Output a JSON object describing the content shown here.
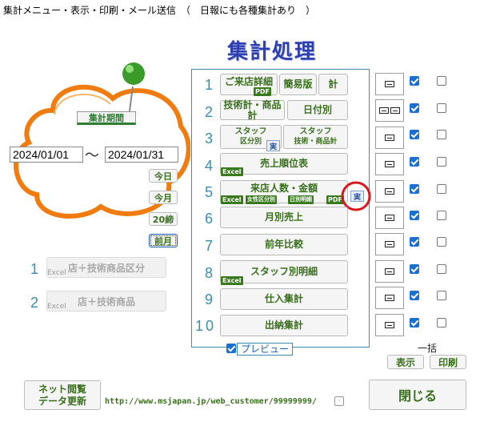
{
  "window": {
    "title": "集計メニュー・表示・印刷・メール送信　（　日報にも各種集計あり　）"
  },
  "header": {
    "title": "集計処理"
  },
  "period": {
    "label": "集計期間",
    "start": "2024/01/01",
    "tilde": "～",
    "end": "2024/01/31",
    "today": "今日",
    "month": "今月",
    "close20": "20締",
    "prev_month": "前月"
  },
  "extra": [
    {
      "num": "1",
      "label": "店＋技術商品区分",
      "sub": "Excel"
    },
    {
      "num": "2",
      "label": "店＋技術商品",
      "sub": "Excel"
    }
  ],
  "rows": [
    {
      "num": "1",
      "b1": "ご来店詳細",
      "b1tag": "PDF",
      "b2": "簡易版",
      "b3": "計"
    },
    {
      "num": "2",
      "b1": "技術計・商品計",
      "b2": "日付別"
    },
    {
      "num": "3",
      "b1a": "スタッフ",
      "b1b": "区分別",
      "jitsu": "実",
      "b2a": "スタッフ",
      "b2b": "技術・商品計"
    },
    {
      "num": "4",
      "label": "売上順位表",
      "tag": "Excel"
    },
    {
      "num": "5",
      "label": "来店人数・金額",
      "tags": [
        "Excel",
        "女性区分別",
        "日別明細",
        "PDF"
      ],
      "jitsu": "実"
    },
    {
      "num": "6",
      "label": "月別売上"
    },
    {
      "num": "7",
      "label": "前年比較"
    },
    {
      "num": "8",
      "label": "スタッフ別明細",
      "tag": "Excel"
    },
    {
      "num": "9",
      "label": "仕入集計"
    },
    {
      "num": "10",
      "label": "出納集計"
    }
  ],
  "checks": {
    "col1": [
      true,
      true,
      true,
      true,
      true,
      true,
      true,
      true,
      true,
      true
    ],
    "col2": [
      false,
      false,
      false,
      false,
      false,
      false,
      false,
      false,
      false,
      false
    ]
  },
  "preview": {
    "label": "プレビュー",
    "checked": true
  },
  "bulk": {
    "label": "一括",
    "show": "表示",
    "print": "印刷"
  },
  "net": {
    "line1": "ネット閲覧",
    "line2": "データ更新"
  },
  "url": "http://www.msjapan.jp/web_customer/99999999/",
  "close_button": "閉じる",
  "colors": {
    "accent": "#3a8db0",
    "green_text": "#3a6f1e",
    "title": "#2f3fb0",
    "highlight_circle": "#d9161e",
    "cloud": "#f07c10"
  }
}
